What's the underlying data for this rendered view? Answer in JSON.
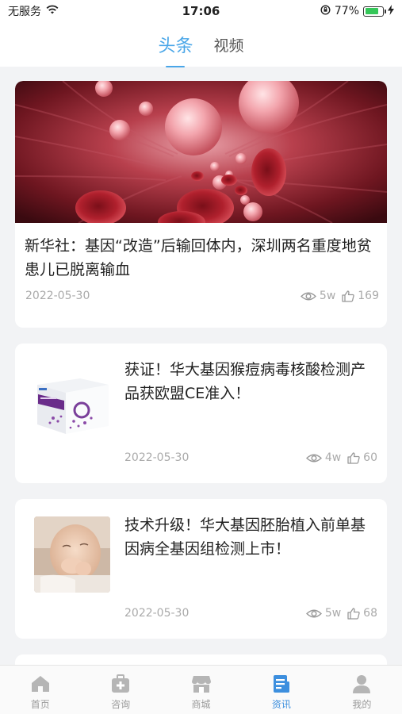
{
  "status_bar": {
    "carrier": "无服务",
    "time": "17:06",
    "battery_percent": "77%",
    "battery_level": 0.77
  },
  "header": {
    "tabs": [
      {
        "label": "头条",
        "active": true
      },
      {
        "label": "视频",
        "active": false
      }
    ]
  },
  "articles": [
    {
      "title": "新华社：基因“改造”后输回体内，深圳两名重度地贫患儿已脱离输血",
      "date": "2022-05-30",
      "views": "5w",
      "likes": "169",
      "image": "red-blood-cells-image"
    },
    {
      "title": "获证！华大基因猴痘病毒核酸检测产品获欧盟CE准入！",
      "date": "2022-05-30",
      "views": "4w",
      "likes": "60",
      "image": "test-kit-box-image"
    },
    {
      "title": "技术升级！华大基因胚胎植入前单基因病全基因组检测上市！",
      "date": "2022-05-30",
      "views": "5w",
      "likes": "68",
      "image": "baby-photo-image"
    }
  ],
  "bottom_nav": {
    "items": [
      {
        "label": "首页",
        "icon": "home-icon",
        "active": false
      },
      {
        "label": "咨询",
        "icon": "medical-kit-icon",
        "active": false
      },
      {
        "label": "商城",
        "icon": "store-icon",
        "active": false
      },
      {
        "label": "资讯",
        "icon": "news-icon",
        "active": true
      },
      {
        "label": "我的",
        "icon": "user-icon",
        "active": false
      }
    ]
  },
  "colors": {
    "accent": "#49a6e8",
    "nav_active": "#3d8fde",
    "meta_text": "#aaaaaa",
    "background": "#f2f3f5"
  }
}
